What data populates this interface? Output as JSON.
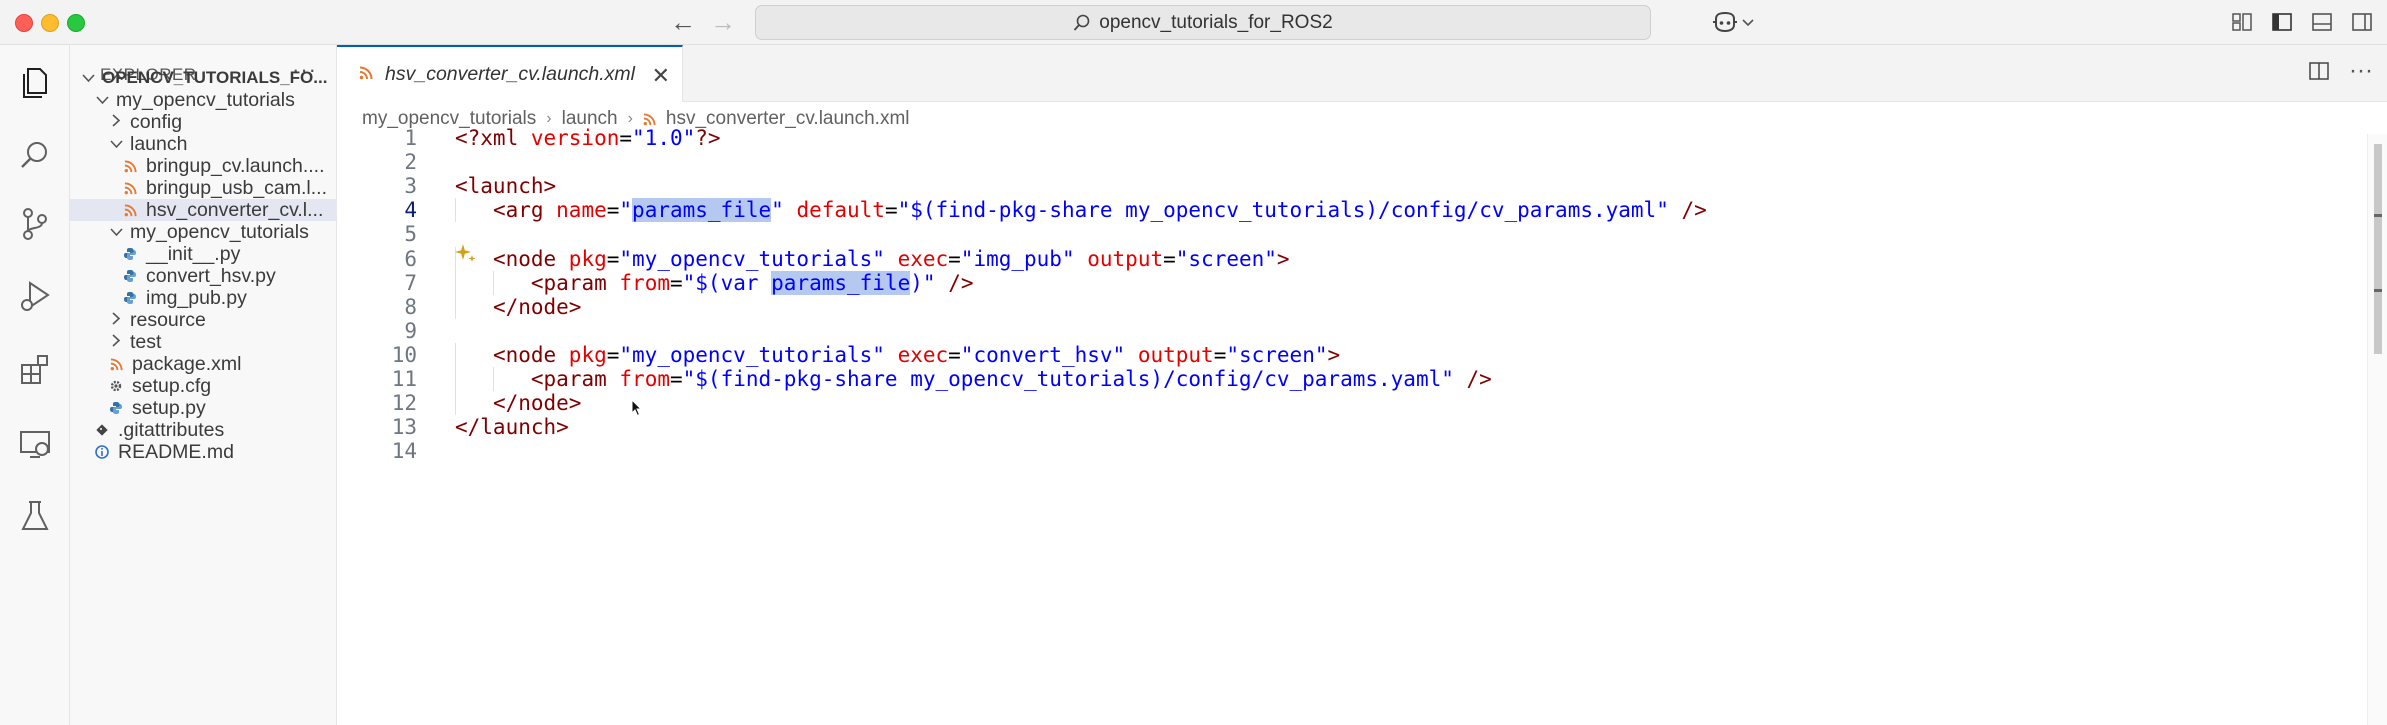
{
  "window": {
    "command_center": "opencv_tutorials_for_ROS2"
  },
  "explorer": {
    "title": "EXPLORER",
    "more": "···",
    "tree": [
      {
        "label": "OPENCV_TUTORIALS_FO...",
        "depth": 0,
        "kind": "root",
        "expanded": true
      },
      {
        "label": "my_opencv_tutorials",
        "depth": 1,
        "kind": "folder",
        "expanded": true
      },
      {
        "label": "config",
        "depth": 2,
        "kind": "folder",
        "expanded": false
      },
      {
        "label": "launch",
        "depth": 2,
        "kind": "folder",
        "expanded": true
      },
      {
        "label": "bringup_cv.launch....",
        "depth": 3,
        "kind": "xml"
      },
      {
        "label": "bringup_usb_cam.l...",
        "depth": 3,
        "kind": "xml"
      },
      {
        "label": "hsv_converter_cv.l...",
        "depth": 3,
        "kind": "xml",
        "selected": true
      },
      {
        "label": "my_opencv_tutorials",
        "depth": 2,
        "kind": "folder",
        "expanded": true
      },
      {
        "label": "__init__.py",
        "depth": 3,
        "kind": "py"
      },
      {
        "label": "convert_hsv.py",
        "depth": 3,
        "kind": "py"
      },
      {
        "label": "img_pub.py",
        "depth": 3,
        "kind": "py"
      },
      {
        "label": "resource",
        "depth": 2,
        "kind": "folder",
        "expanded": false
      },
      {
        "label": "test",
        "depth": 2,
        "kind": "folder",
        "expanded": false
      },
      {
        "label": "package.xml",
        "depth": 2,
        "kind": "xml"
      },
      {
        "label": "setup.cfg",
        "depth": 2,
        "kind": "cfg"
      },
      {
        "label": "setup.py",
        "depth": 2,
        "kind": "py"
      },
      {
        "label": ".gitattributes",
        "depth": 1,
        "kind": "git"
      },
      {
        "label": "README.md",
        "depth": 1,
        "kind": "info"
      }
    ]
  },
  "tab": {
    "label": "hsv_converter_cv.launch.xml",
    "close": "✕"
  },
  "breadcrumb": [
    "my_opencv_tutorials",
    "launch",
    "hsv_converter_cv.launch.xml"
  ],
  "editor": {
    "active_line": 4,
    "lines": [
      {
        "n": "1",
        "indent": 0,
        "tokens": [
          [
            "tag",
            "<?xml "
          ],
          [
            "attr",
            "version"
          ],
          [
            "text",
            "="
          ],
          [
            "val",
            "\"1.0\""
          ],
          [
            "tag",
            "?>"
          ]
        ]
      },
      {
        "n": "2",
        "indent": 0,
        "tokens": []
      },
      {
        "n": "3",
        "indent": 0,
        "tokens": [
          [
            "tag",
            "<launch>"
          ]
        ]
      },
      {
        "n": "4",
        "indent": 1,
        "tokens": [
          [
            "tag",
            "<arg "
          ],
          [
            "attr",
            "name"
          ],
          [
            "text",
            "="
          ],
          [
            "val",
            "\""
          ],
          [
            "valhl",
            "params_file"
          ],
          [
            "val",
            "\""
          ],
          [
            "text",
            " "
          ],
          [
            "attr",
            "default"
          ],
          [
            "text",
            "="
          ],
          [
            "val",
            "\"$(find-pkg-share my_opencv_tutorials)/config/cv_params.yaml\""
          ],
          [
            "text",
            " "
          ],
          [
            "tag",
            "/>"
          ]
        ]
      },
      {
        "n": "5",
        "indent": 0,
        "tokens": []
      },
      {
        "n": "6",
        "indent": 1,
        "tokens": [
          [
            "tag",
            "<node "
          ],
          [
            "attr",
            "pkg"
          ],
          [
            "text",
            "="
          ],
          [
            "val",
            "\"my_opencv_tutorials\""
          ],
          [
            "text",
            " "
          ],
          [
            "attr",
            "exec"
          ],
          [
            "text",
            "="
          ],
          [
            "val",
            "\"img_pub\""
          ],
          [
            "text",
            " "
          ],
          [
            "attr",
            "output"
          ],
          [
            "text",
            "="
          ],
          [
            "val",
            "\"screen\""
          ],
          [
            "tag",
            ">"
          ]
        ]
      },
      {
        "n": "7",
        "indent": 2,
        "tokens": [
          [
            "tag",
            "<param "
          ],
          [
            "attr",
            "from"
          ],
          [
            "text",
            "="
          ],
          [
            "val",
            "\"$(var "
          ],
          [
            "valhl",
            "params_file"
          ],
          [
            "val",
            ")\""
          ],
          [
            "text",
            " "
          ],
          [
            "tag",
            "/>"
          ]
        ]
      },
      {
        "n": "8",
        "indent": 1,
        "tokens": [
          [
            "tag",
            "</node>"
          ]
        ]
      },
      {
        "n": "9",
        "indent": 0,
        "tokens": []
      },
      {
        "n": "10",
        "indent": 1,
        "tokens": [
          [
            "tag",
            "<node "
          ],
          [
            "attr",
            "pkg"
          ],
          [
            "text",
            "="
          ],
          [
            "val",
            "\"my_opencv_tutorials\""
          ],
          [
            "text",
            " "
          ],
          [
            "attr",
            "exec"
          ],
          [
            "text",
            "="
          ],
          [
            "val",
            "\"convert_hsv\""
          ],
          [
            "text",
            " "
          ],
          [
            "attr",
            "output"
          ],
          [
            "text",
            "="
          ],
          [
            "val",
            "\"screen\""
          ],
          [
            "tag",
            ">"
          ]
        ]
      },
      {
        "n": "11",
        "indent": 2,
        "tokens": [
          [
            "tag",
            "<param "
          ],
          [
            "attr",
            "from"
          ],
          [
            "text",
            "="
          ],
          [
            "val",
            "\"$(find-pkg-share my_opencv_tutorials)/config/cv_params.yaml\""
          ],
          [
            "text",
            " "
          ],
          [
            "tag",
            "/>"
          ]
        ]
      },
      {
        "n": "12",
        "indent": 1,
        "tokens": [
          [
            "tag",
            "</node>"
          ]
        ]
      },
      {
        "n": "13",
        "indent": 0,
        "tokens": [
          [
            "tag",
            "</launch>"
          ]
        ]
      },
      {
        "n": "14",
        "indent": 0,
        "tokens": []
      }
    ]
  }
}
